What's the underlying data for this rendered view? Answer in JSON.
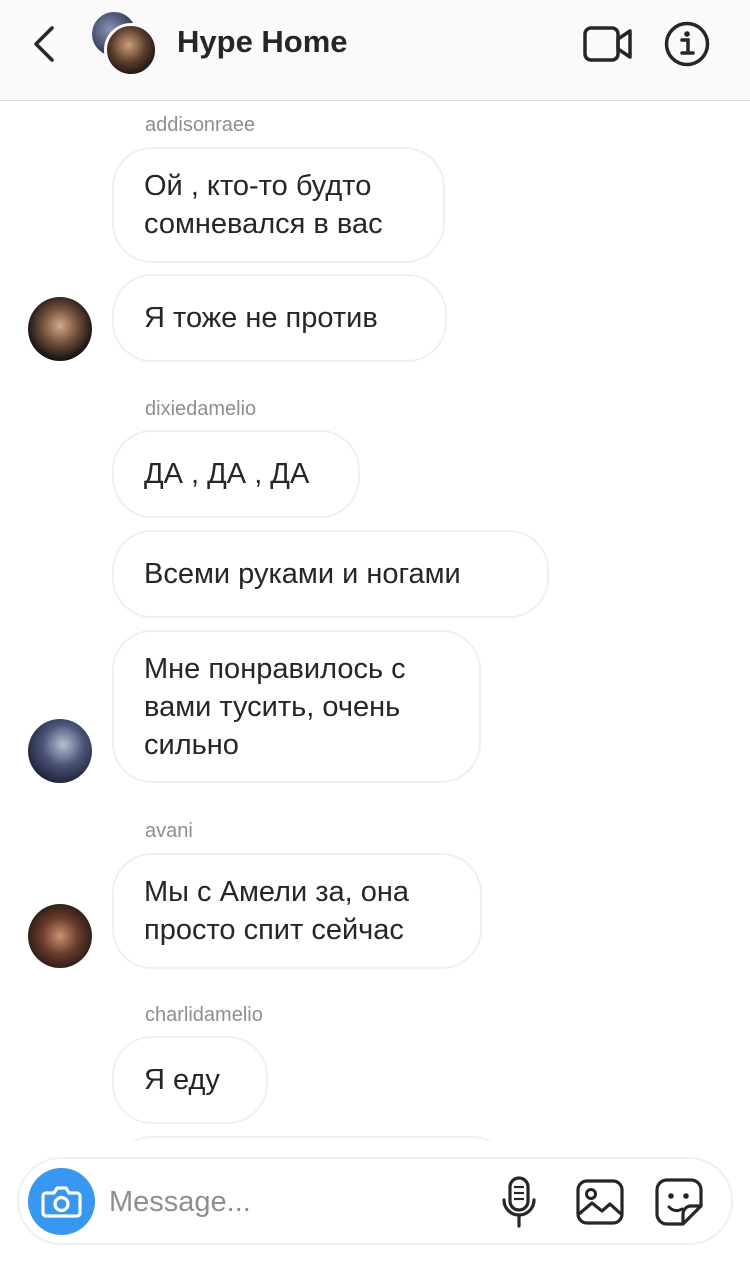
{
  "header": {
    "title": "Hype Home"
  },
  "messages": [
    {
      "sender": "addisonraee",
      "text": "Ой , кто-то будто сомневался в вас"
    },
    {
      "text": "Я тоже не против"
    },
    {
      "sender": "dixiedamelio",
      "text": "ДА , ДА , ДА"
    },
    {
      "text": "Всеми руками и ногами"
    },
    {
      "text": "Мне понравилось с вами тусить, очень сильно"
    },
    {
      "sender": "avani",
      "text": "Мы с Амели за, она просто спит сейчас"
    },
    {
      "sender": "charlidamelio",
      "text": "Я еду"
    }
  ],
  "composer": {
    "placeholder": "Message..."
  },
  "icons": {
    "back": "chevron-left-icon",
    "video": "video-camera-icon",
    "info": "info-icon",
    "camera": "camera-icon",
    "mic": "microphone-icon",
    "gallery": "image-icon",
    "sticker": "sticker-icon"
  },
  "colors": {
    "accent": "#3897f0",
    "bubble_border": "#efefef",
    "muted_text": "#8e8e8e",
    "header_bg": "#fafafa"
  }
}
